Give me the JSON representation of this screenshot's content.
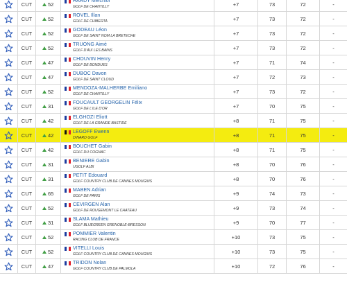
{
  "rows": [
    {
      "pos": "CUT",
      "move": "52",
      "flag": "FR",
      "player": "HARDY Melchior",
      "club": "GOLF DE CHANTILLY",
      "total": "+7",
      "r1": "73",
      "r2": "72",
      "r3": "-",
      "highlighted": false
    },
    {
      "pos": "CUT",
      "move": "52",
      "flag": "FR",
      "player": "ROVEL Illan",
      "club": "GOLF DE CHIBERTA",
      "total": "+7",
      "r1": "73",
      "r2": "72",
      "r3": "-",
      "highlighted": false
    },
    {
      "pos": "CUT",
      "move": "52",
      "flag": "FR",
      "player": "GODEAU Léon",
      "club": "GOLF DE SAINT NOM LA BRETECHE",
      "total": "+7",
      "r1": "73",
      "r2": "72",
      "r3": "-",
      "highlighted": false
    },
    {
      "pos": "CUT",
      "move": "52",
      "flag": "FR",
      "player": "TRUONG Aimé",
      "club": "GOLF D'AIX LES BAINS",
      "total": "+7",
      "r1": "73",
      "r2": "72",
      "r3": "-",
      "highlighted": false
    },
    {
      "pos": "CUT",
      "move": "47",
      "flag": "FR",
      "player": "CHOUVIN Henry",
      "club": "GOLF DE BONDUES",
      "total": "+7",
      "r1": "71",
      "r2": "74",
      "r3": "-",
      "highlighted": false
    },
    {
      "pos": "CUT",
      "move": "47",
      "flag": "FR",
      "player": "DUBOC Davon",
      "club": "GOLF DE SAINT CLOUD",
      "total": "+7",
      "r1": "72",
      "r2": "73",
      "r3": "-",
      "highlighted": false
    },
    {
      "pos": "CUT",
      "move": "52",
      "flag": "FR",
      "player": "MENDOZA-MALHERBE Emiliano",
      "club": "GOLF DE CHANTILLY",
      "total": "+7",
      "r1": "73",
      "r2": "72",
      "r3": "-",
      "highlighted": false
    },
    {
      "pos": "CUT",
      "move": "31",
      "flag": "FR",
      "player": "FOUCAULT GEORGELIN Félix",
      "club": "GOLF DE L'ILE D'OR",
      "total": "+7",
      "r1": "70",
      "r2": "75",
      "r3": "-",
      "highlighted": false
    },
    {
      "pos": "CUT",
      "move": "42",
      "flag": "FR",
      "player": "ELGHOZI Eliott",
      "club": "GOLF DE LA GRANDE BASTIDE",
      "total": "+8",
      "r1": "71",
      "r2": "75",
      "r3": "-",
      "highlighted": false
    },
    {
      "pos": "CUT",
      "move": "42",
      "flag": "BE",
      "player": "LEGOFF Ewenn",
      "club": "DINARD GOLF",
      "total": "+8",
      "r1": "71",
      "r2": "75",
      "r3": "-",
      "highlighted": true
    },
    {
      "pos": "CUT",
      "move": "42",
      "flag": "FR",
      "player": "BOUCHET Gabin",
      "club": "GOLF DU COGNAC",
      "total": "+8",
      "r1": "71",
      "r2": "75",
      "r3": "-",
      "highlighted": false
    },
    {
      "pos": "CUT",
      "move": "31",
      "flag": "FR",
      "player": "BENIERE Gabin",
      "club": "UGOLF ALBI",
      "total": "+8",
      "r1": "70",
      "r2": "76",
      "r3": "-",
      "highlighted": false
    },
    {
      "pos": "CUT",
      "move": "31",
      "flag": "FR",
      "player": "PETIT Edouard",
      "club": "GOLF COUNTRY CLUB DE CANNES MOUGINS",
      "total": "+8",
      "r1": "70",
      "r2": "76",
      "r3": "-",
      "highlighted": false
    },
    {
      "pos": "CUT",
      "move": "65",
      "flag": "FR",
      "player": "MABEN Adrian",
      "club": "GOLF DE PARIS",
      "total": "+9",
      "r1": "74",
      "r2": "73",
      "r3": "-",
      "highlighted": false
    },
    {
      "pos": "CUT",
      "move": "52",
      "flag": "FR",
      "player": "CEVIRGEN Alan",
      "club": "GOLF DE ROUGEMONT LE CHATEAU",
      "total": "+9",
      "r1": "73",
      "r2": "74",
      "r3": "-",
      "highlighted": false
    },
    {
      "pos": "CUT",
      "move": "31",
      "flag": "FR",
      "player": "SLAMA Mathieu",
      "club": "GOLF BLUEGREEN GRENOBLE-BRESSON",
      "total": "+9",
      "r1": "70",
      "r2": "77",
      "r3": "-",
      "highlighted": false
    },
    {
      "pos": "CUT",
      "move": "52",
      "flag": "FR",
      "player": "POMMIER Valentin",
      "club": "RACING CLUB DE FRANCE",
      "total": "+10",
      "r1": "73",
      "r2": "75",
      "r3": "-",
      "highlighted": false
    },
    {
      "pos": "CUT",
      "move": "52",
      "flag": "FR",
      "player": "VITELLI Louis",
      "club": "GOLF COUNTRY CLUB DE CANNES MOUGINS",
      "total": "+10",
      "r1": "73",
      "r2": "75",
      "r3": "-",
      "highlighted": false
    },
    {
      "pos": "CUT",
      "move": "47",
      "flag": "FR",
      "player": "TRIDON Nolan",
      "club": "GOLF COUNTRY CLUB DE PALMOLA",
      "total": "+10",
      "r1": "72",
      "r2": "76",
      "r3": "-",
      "highlighted": false
    }
  ],
  "icons": {
    "favorite": "star-outline-icon",
    "movement": "arrow-up-icon"
  },
  "colors": {
    "link": "#1f5fa8",
    "highlight": "#f4ec10",
    "arrow": "#43a047",
    "star": "#2b59b8",
    "border": "#d6d6d6"
  }
}
